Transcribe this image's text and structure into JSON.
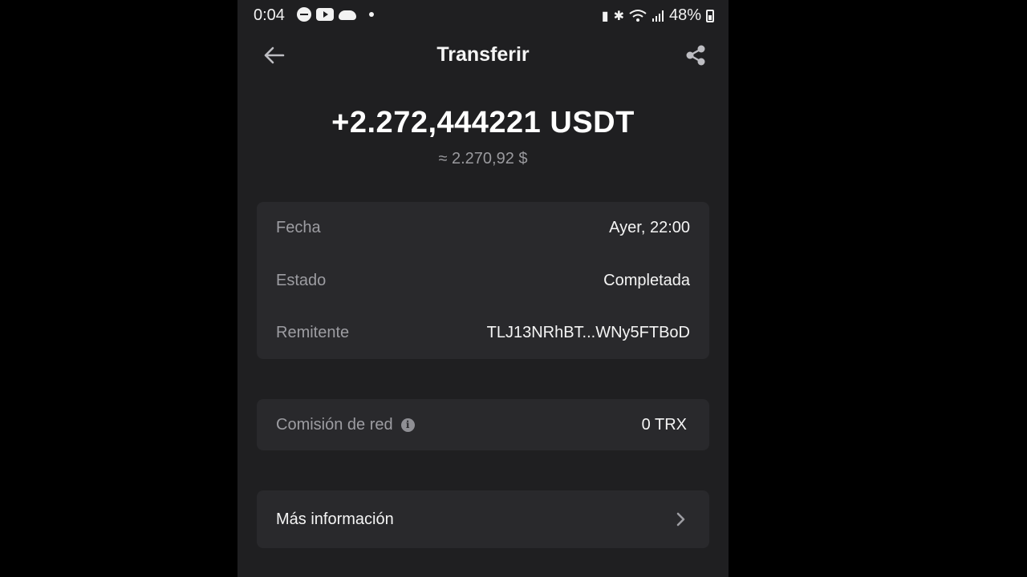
{
  "status_bar": {
    "time": "0:04",
    "battery_percent": "48%",
    "icons": [
      "do-not-disturb-icon",
      "youtube-icon",
      "cloud-icon",
      "notification-dot-icon",
      "battery-saver-icon",
      "bluetooth-icon",
      "wifi-icon",
      "signal-icon",
      "battery-icon"
    ]
  },
  "header": {
    "title": "Transferir",
    "back_icon": "arrow-left-icon",
    "share_icon": "share-icon"
  },
  "amount": {
    "value": "+2.272,444221 USDT",
    "approx": "≈ 2.270,92 $"
  },
  "details": [
    {
      "label": "Fecha",
      "value": "Ayer, 22:00"
    },
    {
      "label": "Estado",
      "value": "Completada"
    },
    {
      "label": "Remitente",
      "value": "TLJ13NRhBT...WNy5FTBoD"
    }
  ],
  "fee": {
    "label": "Comisión de red",
    "value": "0 TRX",
    "info_icon": "info-icon"
  },
  "more": {
    "label": "Más información",
    "chevron_icon": "chevron-right-icon"
  },
  "colors": {
    "background": "#1f1f21",
    "card": "#29292c",
    "muted_text": "#9d9da2",
    "text": "#f5f5f5"
  }
}
